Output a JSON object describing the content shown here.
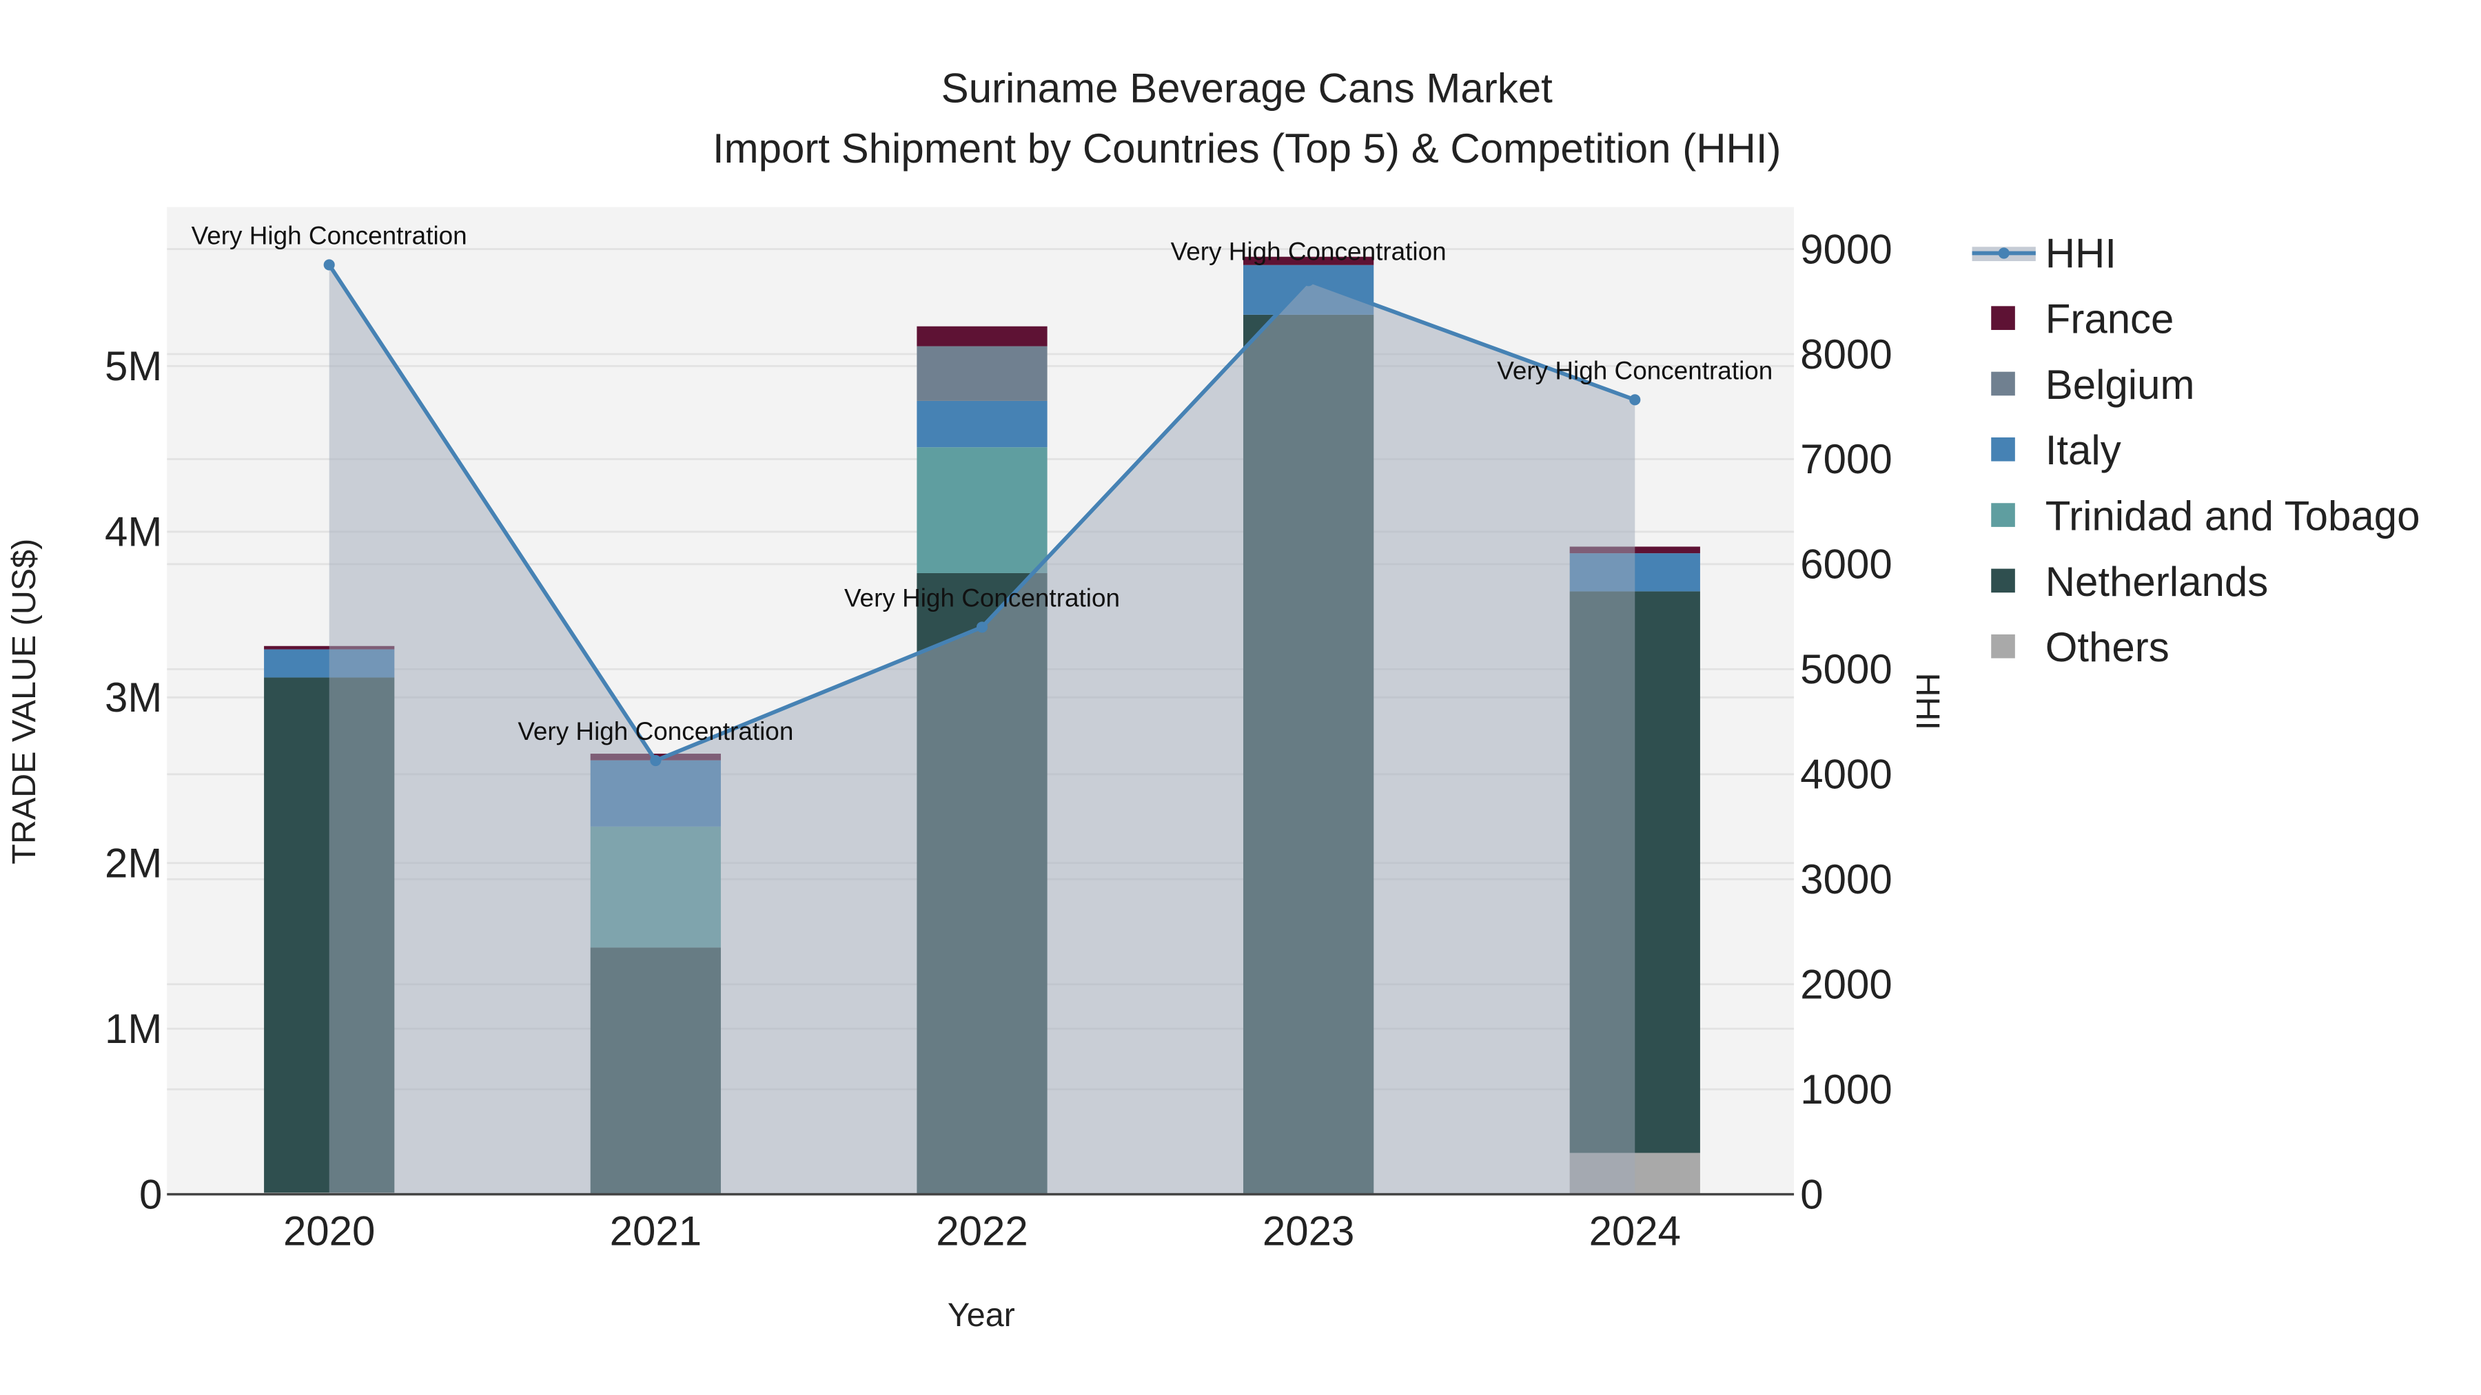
{
  "chart_data": {
    "type": "bar",
    "title": "Suriname Beverage Cans Market",
    "subtitle": "Import Shipment by Countries (Top 5) & Competition (HHI)",
    "xlabel": "Year",
    "ylabel": "TRADE VALUE (US$)",
    "y2label": "HHI",
    "categories": [
      "2020",
      "2021",
      "2022",
      "2023",
      "2024"
    ],
    "ylim": [
      0,
      5960000
    ],
    "y2lim": [
      0,
      9400
    ],
    "yticks": [
      {
        "v": 0,
        "label": "0"
      },
      {
        "v": 1000000,
        "label": "1M"
      },
      {
        "v": 2000000,
        "label": "2M"
      },
      {
        "v": 3000000,
        "label": "3M"
      },
      {
        "v": 4000000,
        "label": "4M"
      },
      {
        "v": 5000000,
        "label": "5M"
      }
    ],
    "y2ticks": [
      0,
      1000,
      2000,
      3000,
      4000,
      5000,
      6000,
      7000,
      8000,
      9000
    ],
    "series": [
      {
        "name": "Others",
        "color": "#a9a9a9",
        "values": [
          10000,
          0,
          0,
          0,
          250000
        ]
      },
      {
        "name": "Netherlands",
        "color": "#2f4f4f",
        "values": [
          3110000,
          1490000,
          3750000,
          5310000,
          3390000
        ]
      },
      {
        "name": "Trinidad and Tobago",
        "color": "#5f9ea0",
        "values": [
          0,
          730000,
          760000,
          0,
          0
        ]
      },
      {
        "name": "Italy",
        "color": "#4682b4",
        "values": [
          170000,
          400000,
          280000,
          300000,
          230000
        ]
      },
      {
        "name": "Belgium",
        "color": "#708090",
        "values": [
          0,
          0,
          330000,
          0,
          0
        ]
      },
      {
        "name": "France",
        "color": "#5e1234",
        "values": [
          20000,
          40000,
          120000,
          50000,
          40000
        ]
      }
    ],
    "hhi": {
      "name": "HHI",
      "color": "#4682b4",
      "values": [
        8850,
        4130,
        5400,
        8700,
        7565
      ]
    },
    "annotations": [
      "Very High Concentration",
      "Very High Concentration",
      "Very High Concentration",
      "Very High Concentration",
      "Very High Concentration"
    ],
    "legend_order": [
      "HHI",
      "France",
      "Belgium",
      "Italy",
      "Trinidad and Tobago",
      "Netherlands",
      "Others"
    ],
    "legend_position": "right"
  }
}
